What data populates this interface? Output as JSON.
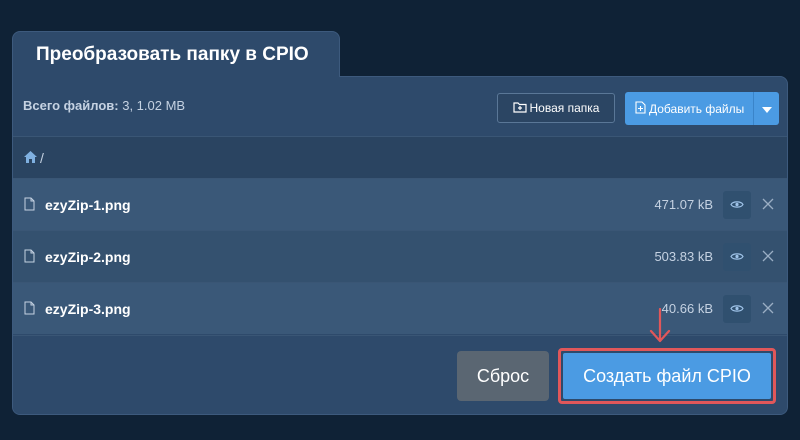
{
  "tab": {
    "title": "Преобразовать папку в CPIO"
  },
  "toolbar": {
    "total_label": "Всего файлов:",
    "total_value": "3, 1.02 MB",
    "new_folder_label": "Новая папка",
    "add_files_label": "Добавить файлы"
  },
  "breadcrumb": {
    "separator": "/"
  },
  "files": [
    {
      "name": "ezyZip-1.png",
      "size": "471.07 kB"
    },
    {
      "name": "ezyZip-2.png",
      "size": "503.83 kB"
    },
    {
      "name": "ezyZip-3.png",
      "size": "40.66 kB"
    }
  ],
  "footer": {
    "reset_label": "Сброс",
    "create_label": "Создать файл CPIO"
  },
  "colors": {
    "background": "#0f2236",
    "panel": "#2e4a6b",
    "accent": "#4b9be3",
    "highlight": "#e0575a"
  }
}
